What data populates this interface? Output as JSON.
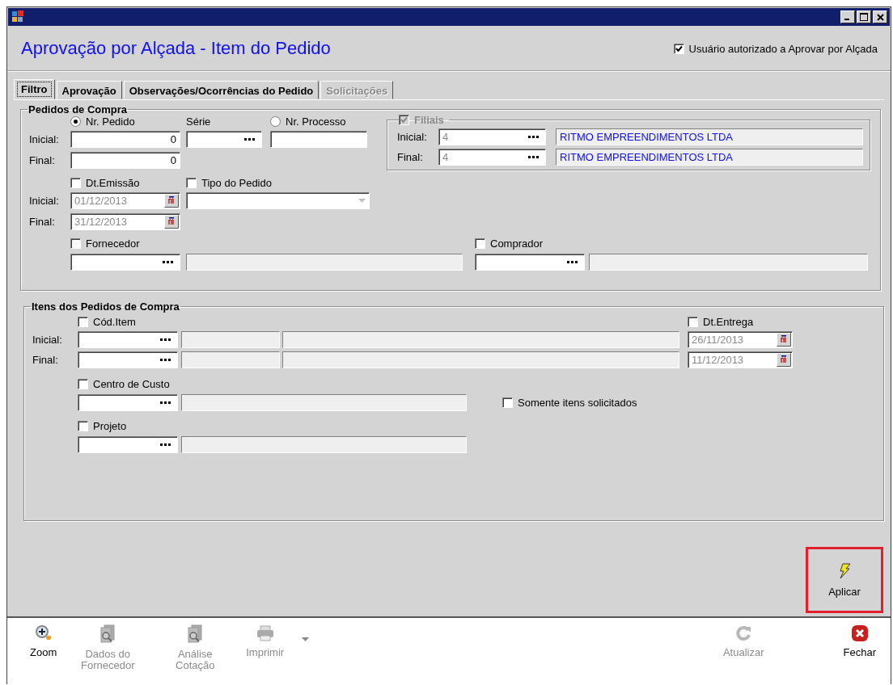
{
  "window": {
    "title": "Aprovação por Alçada  - Item do Pedido"
  },
  "authorized": {
    "label": "Usuário autorizado a Aprovar por Alçada",
    "checked": true
  },
  "tabs": [
    {
      "label": "Filtro",
      "selected": true,
      "disabled": false
    },
    {
      "label": "Aprovação",
      "selected": false,
      "disabled": false
    },
    {
      "label": "Observações/Ocorrências do Pedido",
      "selected": false,
      "disabled": false
    },
    {
      "label": "Solicitações",
      "selected": false,
      "disabled": true
    }
  ],
  "pedidos": {
    "title": "Pedidos de Compra",
    "radios": [
      {
        "label": "Nr. Pedido",
        "selected": true
      },
      {
        "label": "Nr. Processo",
        "selected": false
      }
    ],
    "serie_label": "Série",
    "nr_pedido": [
      {
        "label": "Inicial:",
        "value": "0"
      },
      {
        "label": "Final:",
        "value": "0"
      }
    ],
    "dt_emissao": {
      "label": "Dt.Emissão",
      "checked": false,
      "rows": [
        {
          "label": "Inicial:",
          "value": "01/12/2013"
        },
        {
          "label": "Final:",
          "value": "31/12/2013"
        }
      ]
    },
    "tipo_pedido": {
      "label": "Tipo do Pedido",
      "checked": false
    },
    "filiais": {
      "label": "Filiais",
      "checked": true,
      "disabled": true,
      "rows": [
        {
          "label": "Inicial:",
          "code": "4",
          "name": "RITMO EMPREENDIMENTOS LTDA"
        },
        {
          "label": "Final:",
          "code": "4",
          "name": "RITMO EMPREENDIMENTOS LTDA"
        }
      ]
    },
    "fornecedor": {
      "label": "Fornecedor",
      "checked": false
    },
    "comprador": {
      "label": "Comprador",
      "checked": false
    }
  },
  "itens": {
    "title": "Itens dos Pedidos de Compra",
    "cod_item": {
      "label": "Cód.Item",
      "checked": false,
      "rows": [
        {
          "label": "Inicial:"
        },
        {
          "label": "Final:"
        }
      ]
    },
    "dt_entrega": {
      "label": "Dt.Entrega",
      "checked": false,
      "values": [
        "26/11/2013",
        "11/12/2013"
      ]
    },
    "centro_custo": {
      "label": "Centro de Custo",
      "checked": false
    },
    "somente": {
      "label": "Somente itens solicitados",
      "checked": false
    },
    "projeto": {
      "label": "Projeto",
      "checked": false
    }
  },
  "apply_button": {
    "label": "Aplicar"
  },
  "toolbar_left": [
    {
      "label": "Zoom",
      "kind": "zoom",
      "disabled": false,
      "dropdown": false
    },
    {
      "label": "Dados do Fornecedor",
      "kind": "doc-search",
      "disabled": true,
      "dropdown": false
    },
    {
      "label": "Análise Cotação",
      "kind": "doc-search",
      "disabled": true,
      "dropdown": false
    },
    {
      "label": "Imprimir",
      "kind": "print",
      "disabled": true,
      "dropdown": true
    }
  ],
  "toolbar_right": [
    {
      "label": "Atualizar",
      "kind": "refresh",
      "disabled": true,
      "dropdown": false
    },
    {
      "label": "Fechar",
      "kind": "close",
      "disabled": false,
      "dropdown": false
    }
  ]
}
